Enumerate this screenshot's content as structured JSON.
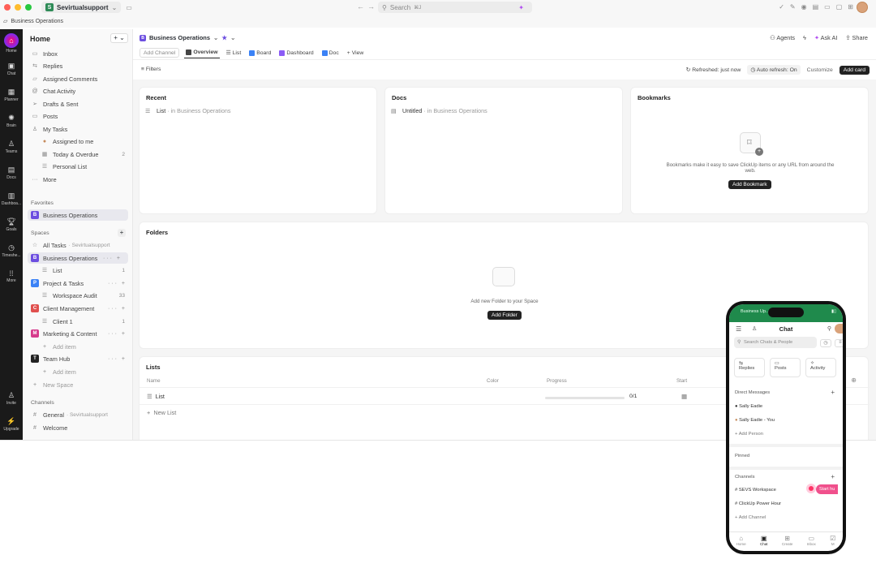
{
  "topbar": {
    "workspace_badge": "S",
    "workspace": "Sevirtualsupport",
    "search_placeholder": "Search",
    "search_shortcut": "⌘J"
  },
  "breadcrumb": "Business Operations",
  "rail": [
    {
      "label": "Home",
      "icon": "home-icon"
    },
    {
      "label": "Chat",
      "icon": "chat-icon"
    },
    {
      "label": "Planner",
      "icon": "calendar-icon"
    },
    {
      "label": "Brain",
      "icon": "brain-icon"
    },
    {
      "label": "Teams",
      "icon": "teams-icon"
    },
    {
      "label": "Docs",
      "icon": "docs-icon"
    },
    {
      "label": "Dashboa...",
      "icon": "dashboard-icon"
    },
    {
      "label": "Goals",
      "icon": "goals-icon"
    },
    {
      "label": "Timeshe...",
      "icon": "timesheet-icon"
    },
    {
      "label": "More",
      "icon": "more-icon"
    },
    {
      "label": "Invite",
      "icon": "invite-icon"
    },
    {
      "label": "Upgrade",
      "icon": "upgrade-icon"
    }
  ],
  "sidebar": {
    "title": "Home",
    "nav": [
      "Inbox",
      "Replies",
      "Assigned Comments",
      "Chat Activity",
      "Drafts & Sent",
      "Posts",
      "My Tasks"
    ],
    "my_tasks": [
      {
        "label": "Assigned to me",
        "count": ""
      },
      {
        "label": "Today & Overdue",
        "count": "2"
      },
      {
        "label": "Personal List",
        "count": ""
      }
    ],
    "more": "More",
    "favorites_header": "Favorites",
    "favorite": {
      "badge": "B",
      "label": "Business Operations"
    },
    "spaces_header": "Spaces",
    "all_tasks": "All Tasks",
    "all_tasks_meta": "· Sevirtualsupport",
    "spaces": [
      {
        "badge": "B",
        "color": "#6c4ee0",
        "label": "Business Operations",
        "child": "List",
        "child_count": "1"
      },
      {
        "badge": "P",
        "color": "#3b82f6",
        "label": "Project & Tasks",
        "child": "Workspace Audit",
        "child_count": "33"
      },
      {
        "badge": "C",
        "color": "#e0504e",
        "label": "Client Management",
        "child": "Client 1",
        "child_count": "1"
      },
      {
        "badge": "M",
        "color": "#d63a8c",
        "label": "Marketing & Content",
        "child": "Add item",
        "child_count": ""
      },
      {
        "badge": "T",
        "color": "#222222",
        "label": "Team Hub",
        "child": "Add item",
        "child_count": ""
      }
    ],
    "new_space": "New Space",
    "channels_header": "Channels",
    "channels": [
      {
        "label": "General",
        "meta": "· Sevirtualsupport"
      },
      {
        "label": "Welcome",
        "meta": ""
      }
    ]
  },
  "main": {
    "title_badge": "B",
    "title": "Business Operations",
    "right_actions": [
      "Agents",
      "Ask AI",
      "Share"
    ],
    "tabs": [
      "Add Channel",
      "Overview",
      "List",
      "Board",
      "Dashboard",
      "Doc",
      "View"
    ],
    "filters": "Filters",
    "refreshed": "Refreshed: just now",
    "auto_refresh": "Auto refresh: On",
    "customize": "Customize",
    "add_card": "Add card",
    "recent": {
      "title": "Recent",
      "item": "List",
      "meta": "· in Business Operations"
    },
    "docs": {
      "title": "Docs",
      "item": "Untitled",
      "meta": "· in Business Operations"
    },
    "bookmarks": {
      "title": "Bookmarks",
      "text": "Bookmarks make it easy to save ClickUp items or any URL from around the web.",
      "button": "Add Bookmark"
    },
    "folders": {
      "title": "Folders",
      "text": "Add new Folder to your Space",
      "button": "Add Folder"
    },
    "lists": {
      "title": "Lists",
      "columns": [
        "Name",
        "Color",
        "Progress",
        "Start"
      ],
      "rows": [
        {
          "name": "List",
          "progress": "0/1",
          "progress_fraction": 0
        }
      ],
      "new_list": "New List"
    }
  },
  "phone": {
    "status_left": "Business Up...",
    "header": "Chat",
    "search_placeholder": "Search Chats & People",
    "quick": [
      "Replies",
      "Posts",
      "Activity"
    ],
    "dm_header": "Direct Messages",
    "dms": [
      "Sally Eadie",
      "Sally Eadie - You"
    ],
    "add_person": "Add Person",
    "pinned": "Pinned",
    "channels_header": "Channels",
    "channels": [
      "SEVS Workspace",
      "ClickUp Power Hour"
    ],
    "start_button": "Start hu",
    "add_channel": "Add Channel",
    "tabbar": [
      "Home",
      "Chat",
      "Create",
      "Inbox",
      "M"
    ]
  }
}
